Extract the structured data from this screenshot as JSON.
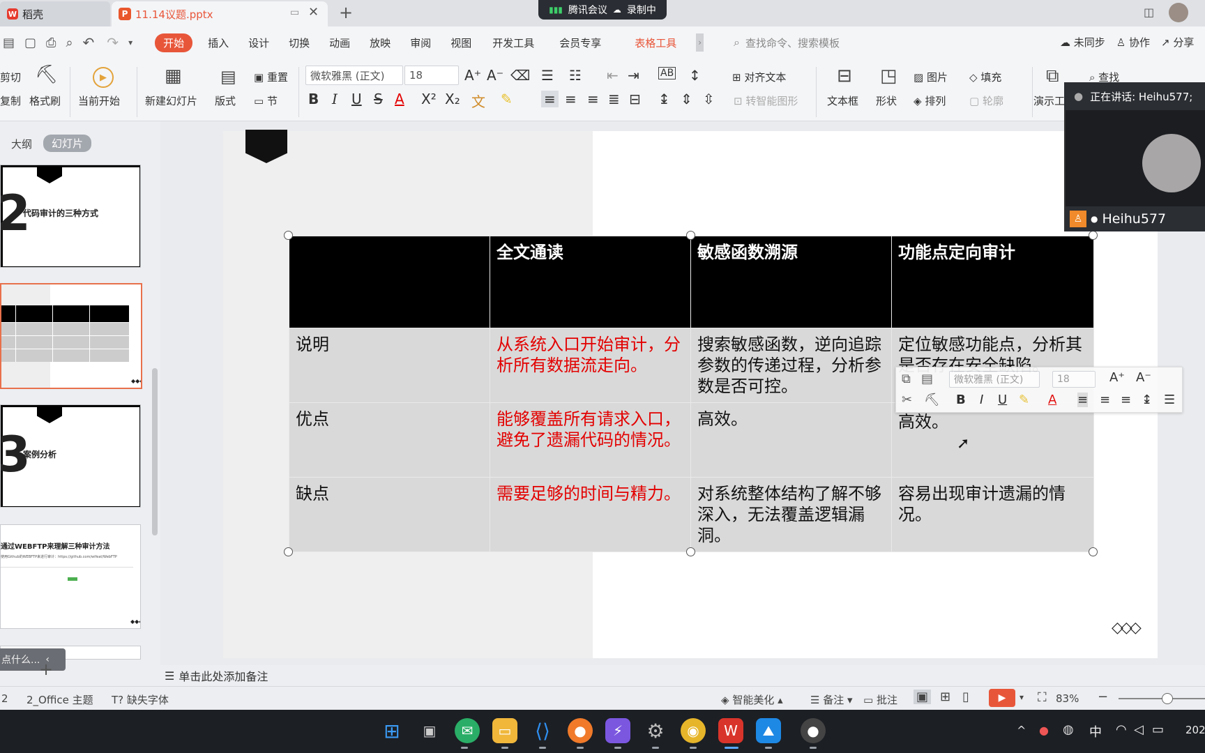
{
  "titlebar": {
    "tab1": "稻壳",
    "tab2": "11.14议题.pptx",
    "meeting": "腾讯会议",
    "recording": "录制中"
  },
  "menu": {
    "items": [
      "开始",
      "插入",
      "设计",
      "切换",
      "动画",
      "放映",
      "审阅",
      "视图",
      "开发工具",
      "会员专享",
      "表格工具"
    ],
    "search_placeholder": "查找命令、搜索模板",
    "sync": "未同步",
    "collab": "协作",
    "share": "分享"
  },
  "ribbon": {
    "cut": "剪切",
    "copy": "复制",
    "format_painter": "格式刷",
    "play_from_current": "当前开始",
    "new_slide": "新建幻灯片",
    "layout": "版式",
    "reset": "重置",
    "section": "节",
    "font_name": "微软雅黑 (正文)",
    "font_size": "18",
    "align_text": "对齐文本",
    "smart_shape": "转智能图形",
    "textbox": "文本框",
    "shape": "形状",
    "picture": "图片",
    "arrange": "排列",
    "fill": "填充",
    "outline": "轮廓",
    "presenter": "演示工",
    "find": "查找"
  },
  "panel": {
    "tab_outline": "大纲",
    "tab_slides": "幻灯片",
    "slide2_num": "2",
    "slide2_title": "代码审计的三种方式",
    "slide3_num": "3",
    "slide3_title": "案例分析",
    "slide4_title": "通过WEBFTP来理解三种审计方法",
    "slide4_sub": "使用Github的WEBFTP来进行审计：https://github.com/wifeat/WebFTP",
    "bottom_hint": "点什么..."
  },
  "table": {
    "header": [
      "",
      "全文通读",
      "敏感函数溯源",
      "功能点定向审计"
    ],
    "rows": [
      [
        "说明",
        "从系统入口开始审计，分析所有数据流走向。",
        "搜索敏感函数，逆向追踪参数的传递过程，分析参数是否可控。",
        "定位敏感功能点，分析其是否存在安全缺陷。"
      ],
      [
        "优点",
        "能够覆盖所有请求入口，避免了遗漏代码的情况。",
        "高效。",
        "高效。"
      ],
      [
        "缺点",
        "需要足够的时间与精力。",
        "对系统整体结构了解不够深入，无法覆盖逻辑漏洞。",
        "容易出现审计遗漏的情况。"
      ]
    ]
  },
  "floatbar": {
    "font_name": "微软雅黑 (正文)",
    "font_size": "18"
  },
  "video": {
    "speaking": "正在讲话: Heihu577;",
    "name": "Heihu577"
  },
  "notes": {
    "placeholder": "单击此处添加备注"
  },
  "status": {
    "page": "2",
    "theme": "2_Office 主题",
    "missing_font": "缺失字体",
    "beautify": "智能美化",
    "notes": "备注",
    "comment": "批注",
    "zoom": "83%"
  },
  "taskbar": {
    "ime": "中",
    "time": "202"
  },
  "colors": {
    "accent": "#e8563a",
    "red_text": "#e30000",
    "table_head": "#000000",
    "table_body": "#d9d9d9"
  }
}
